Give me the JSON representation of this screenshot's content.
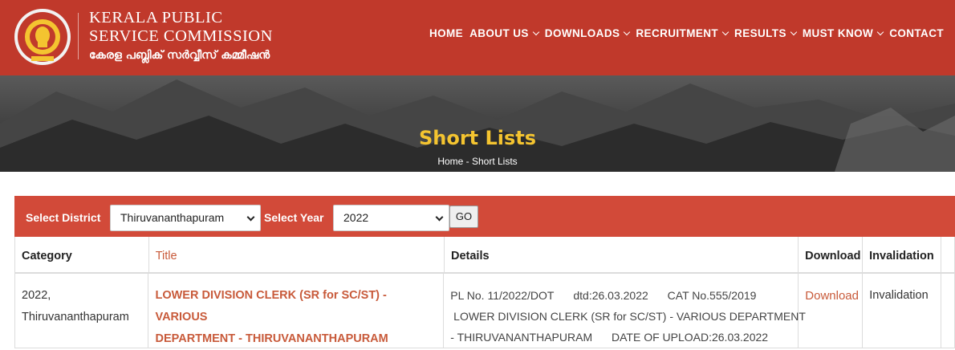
{
  "header": {
    "brand_line1": "KERALA PUBLIC",
    "brand_line2": "SERVICE COMMISSION",
    "brand_line3": "കേരള പബ്ലിക് സർവ്വീസ് കമ്മീഷൻ",
    "logo_icon": "kerala-emblem-icon",
    "nav": [
      {
        "label": "HOME",
        "dropdown": false
      },
      {
        "label": "ABOUT US",
        "dropdown": true
      },
      {
        "label": "DOWNLOADS",
        "dropdown": true
      },
      {
        "label": "RECRUITMENT",
        "dropdown": true
      },
      {
        "label": "RESULTS",
        "dropdown": true
      },
      {
        "label": "MUST KNOW",
        "dropdown": true
      },
      {
        "label": "CONTACT",
        "dropdown": false
      }
    ]
  },
  "banner": {
    "title": "Short Lists",
    "breadcrumb": "Home - Short Lists"
  },
  "filter": {
    "district_label": "Select District",
    "district_value": "Thiruvananthapuram",
    "year_label": "Select Year",
    "year_value": "2022",
    "go_label": "GO"
  },
  "table": {
    "headers": [
      "Category",
      "Title",
      "Details",
      "Download",
      "Invalidation"
    ],
    "rows": [
      {
        "category_line1": "2022,",
        "category_line2": "Thiruvananthapuram",
        "title_line1": "LOWER DIVISION CLERK (SR for SC/ST) - VARIOUS",
        "title_line2": "DEPARTMENT - THIRUVANANTHAPURAM",
        "details_pl": "PL No. 11/2022/DOT",
        "details_dtd": "dtd:26.03.2022",
        "details_cat": "CAT No.555/2019",
        "details_line2": " LOWER DIVISION CLERK (SR for SC/ST) - VARIOUS DEPARTMENT",
        "details_line3a": "- THIRUVANANTHAPURAM",
        "details_line3b": "DATE OF UPLOAD:26.03.2022",
        "download": "Download",
        "invalidation": "Invalidation"
      }
    ]
  },
  "colors": {
    "header_bg": "#c0392b",
    "filter_bg": "#d24a39",
    "banner_title": "#f4c430",
    "link": "#c85a3a"
  }
}
